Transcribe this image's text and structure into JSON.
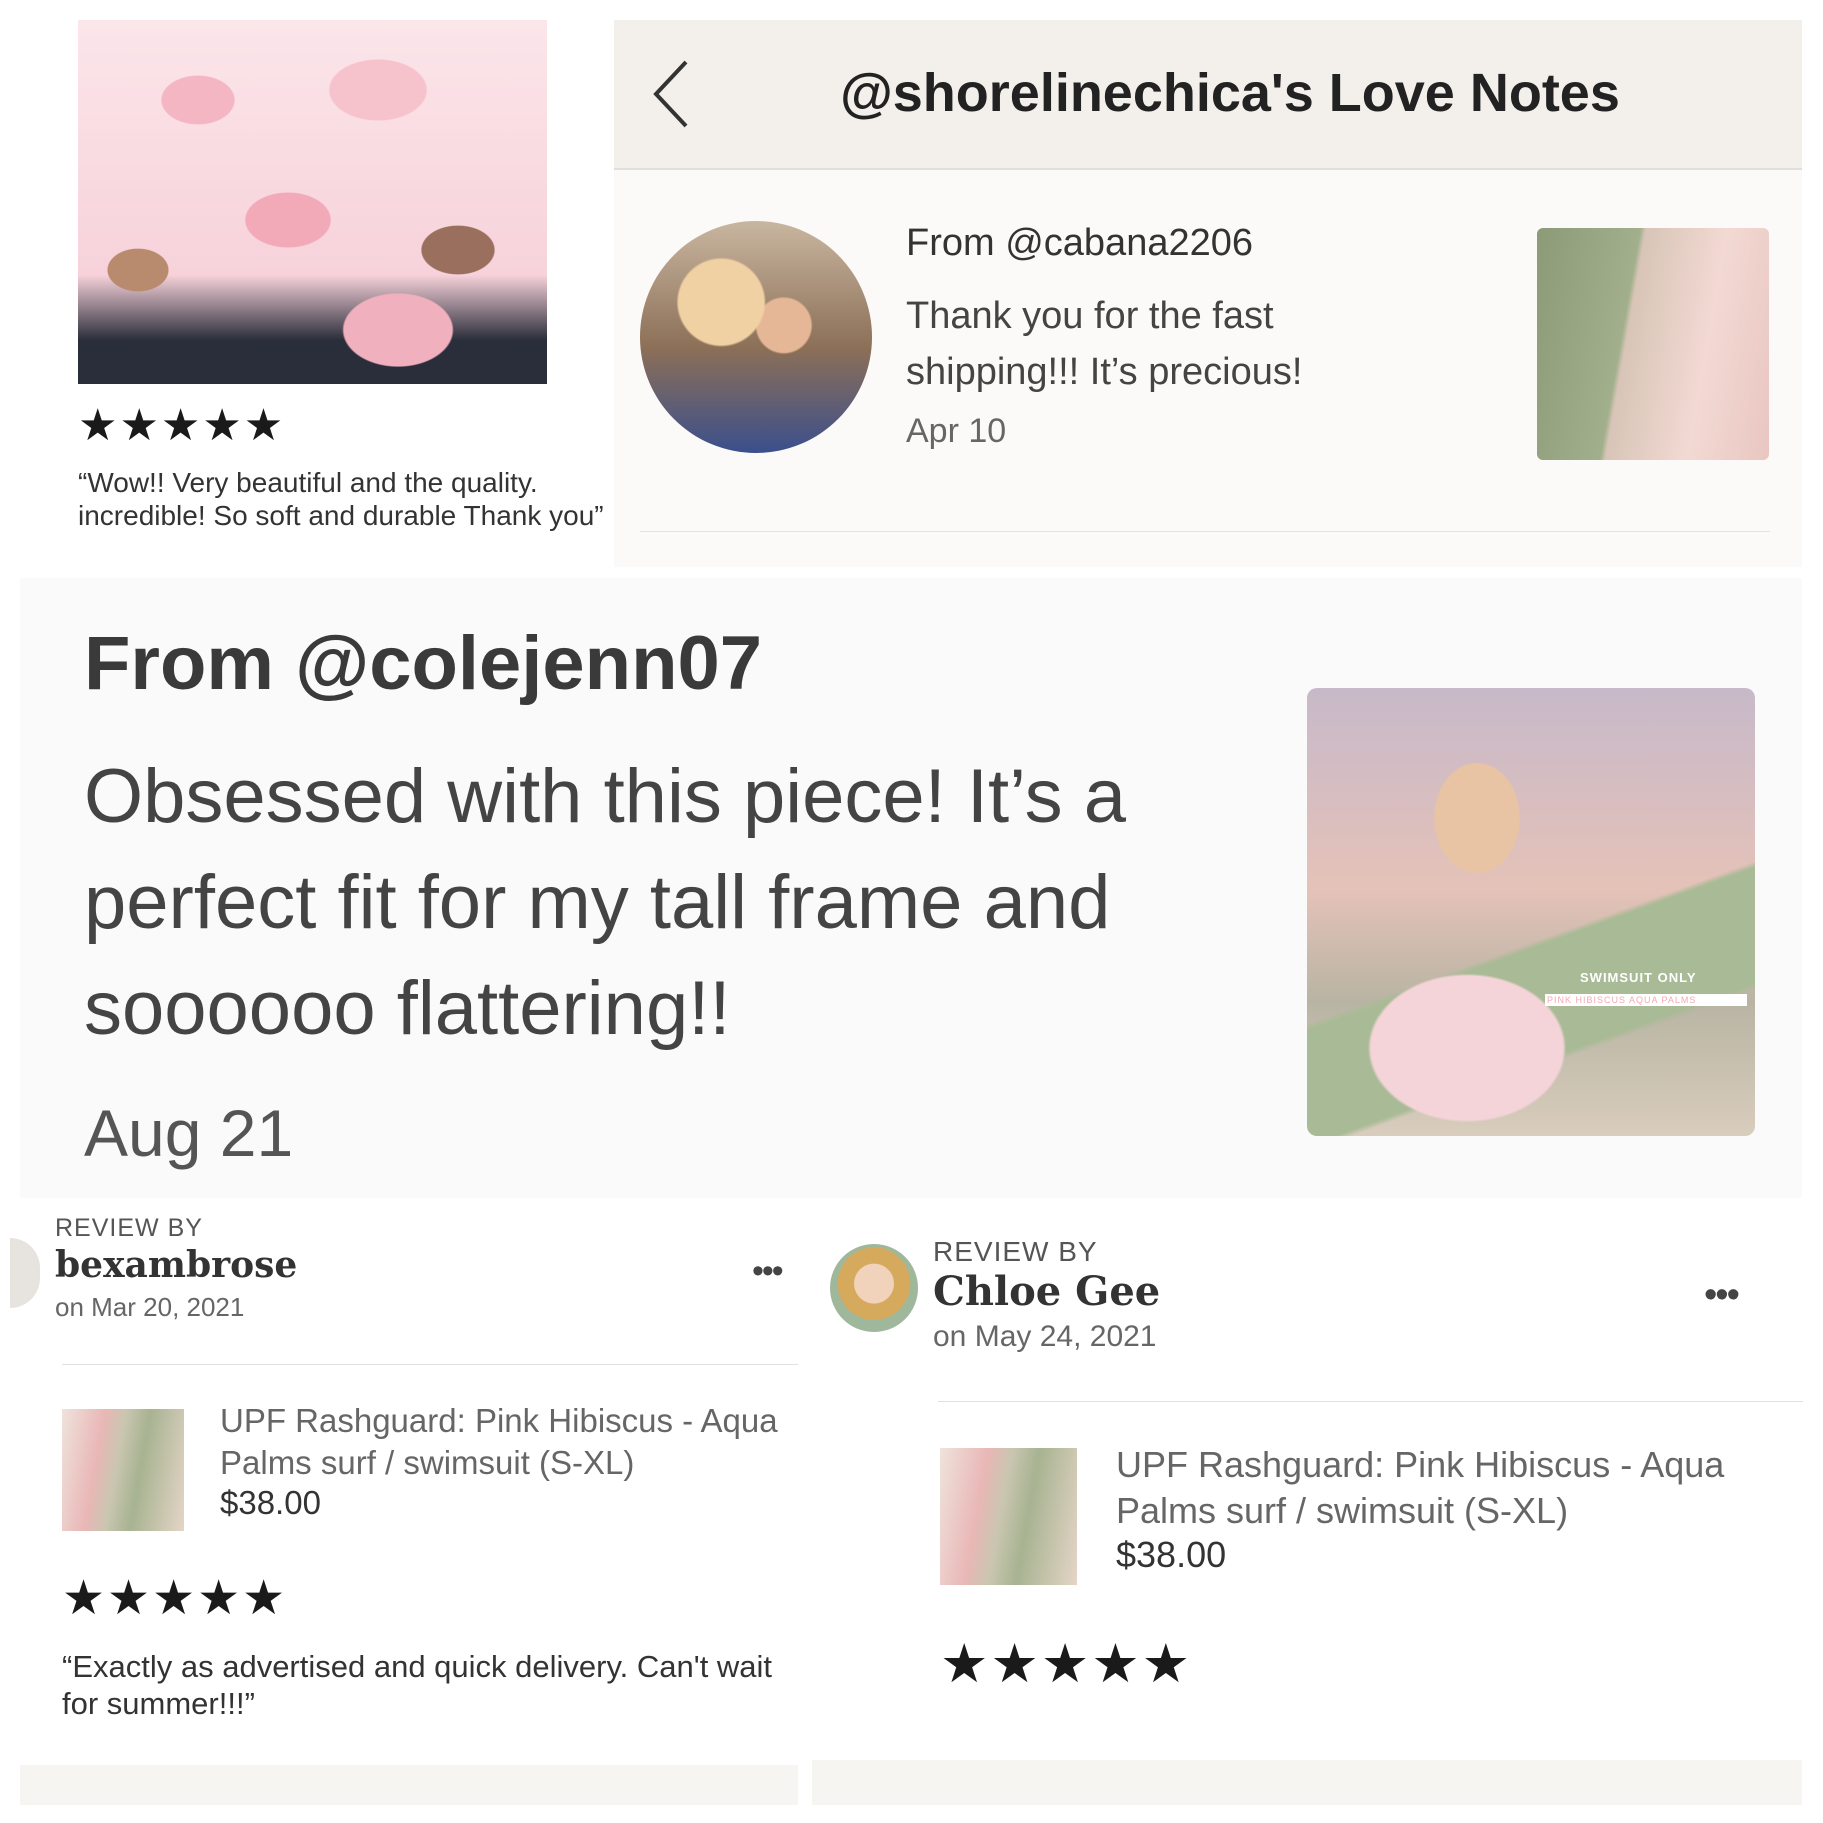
{
  "top_left_review": {
    "stars": "★★★★★",
    "quote": "“Wow!! Very beautiful and the quality. incredible! So soft and durable Thank you”"
  },
  "love_notes": {
    "title": "@shorelinechica's Love Notes",
    "note": {
      "from": "From @cabana2206",
      "message": "Thank you for the fast shipping!!! It’s precious!",
      "date": "Apr 10"
    }
  },
  "colejenn_note": {
    "from": "From @colejenn07",
    "message": "Obsessed with this piece! It’s a perfect fit for my tall frame and soooooo flattering!!",
    "date": "Aug 21",
    "photo_watermark_line1": "SWIMSUIT ONLY",
    "photo_watermark_line2": "PINK HIBISCUS AQUA PALMS"
  },
  "review_left": {
    "review_by_label": "REVIEW BY",
    "reviewer": "bexambrose",
    "date": "on Mar 20, 2021",
    "more_icon": "•••",
    "product_title": "UPF Rashguard: Pink Hibiscus - Aqua Palms surf / swimsuit (S-XL)",
    "price": "$38.00",
    "stars": "★★★★★",
    "quote": "“Exactly as advertised and quick delivery. Can't wait for summer!!!”"
  },
  "review_right": {
    "review_by_label": "REVIEW BY",
    "reviewer": "Chloe Gee",
    "date": "on May 24, 2021",
    "more_icon": "•••",
    "product_title": "UPF Rashguard: Pink Hibiscus - Aqua Palms surf / swimsuit (S-XL)",
    "price": "$38.00",
    "stars": "★★★★★"
  }
}
